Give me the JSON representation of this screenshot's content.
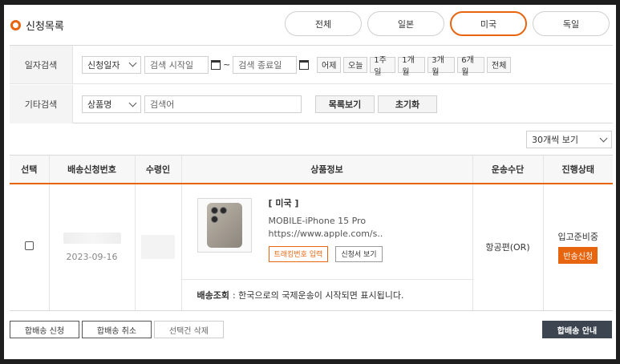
{
  "header": {
    "title": "신청목록"
  },
  "tabs": [
    {
      "label": "전체",
      "active": false
    },
    {
      "label": "일본",
      "active": false
    },
    {
      "label": "미국",
      "active": true
    },
    {
      "label": "독일",
      "active": false
    }
  ],
  "filter": {
    "date_label": "일자검색",
    "date_type": "신청일자",
    "start_placeholder": "검색 시작일",
    "tilde": "~",
    "end_placeholder": "검색 종료일",
    "periods": [
      "어제",
      "오늘",
      "1주일",
      "1개월",
      "3개월",
      "6개월",
      "전체"
    ],
    "etc_label": "기타검색",
    "etc_type": "상품명",
    "keyword_placeholder": "검색어",
    "list_button": "목록보기",
    "reset_button": "초기화"
  },
  "per_page": "30개씩 보기",
  "table": {
    "headers": [
      "선택",
      "배송신청번호",
      "수령인",
      "상품정보",
      "운송수단",
      "진행상태"
    ],
    "rows": [
      {
        "date": "2023-09-16",
        "country": "[ 미국 ]",
        "product_name": "MOBILE-iPhone 15 Pro",
        "product_url": "https://www.apple.com/s..",
        "tracking_button": "트래킹번호 입력",
        "form_button": "신청서 보기",
        "tracking_label": "배송조회",
        "tracking_text": ": 한국으로의 국제운송이 시작되면 표시됩니다.",
        "transport": "항공편(OR)",
        "status": "입고준비중",
        "status_button": "반송신청"
      }
    ]
  },
  "bottom": {
    "combine_request": "합배송 신청",
    "combine_cancel": "합배송 취소",
    "delete_selected": "선택건 삭제",
    "combine_guide": "합배송 안내"
  },
  "colors": {
    "accent": "#e8650f",
    "dark_button": "#3d4550"
  }
}
